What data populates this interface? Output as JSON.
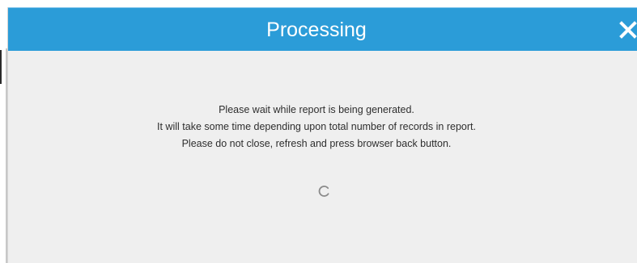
{
  "dialog": {
    "title": "Processing",
    "close_icon": "close-icon",
    "messages": [
      "Please wait while report is being generated.",
      "It will take some time depending upon total number of records in report.",
      "Please do not close, refresh and press browser back button."
    ],
    "spinner_icon": "loading-spinner-icon"
  },
  "colors": {
    "titlebar": "#2b9cd8",
    "body": "#efefef",
    "text": "#2e2e2e"
  }
}
